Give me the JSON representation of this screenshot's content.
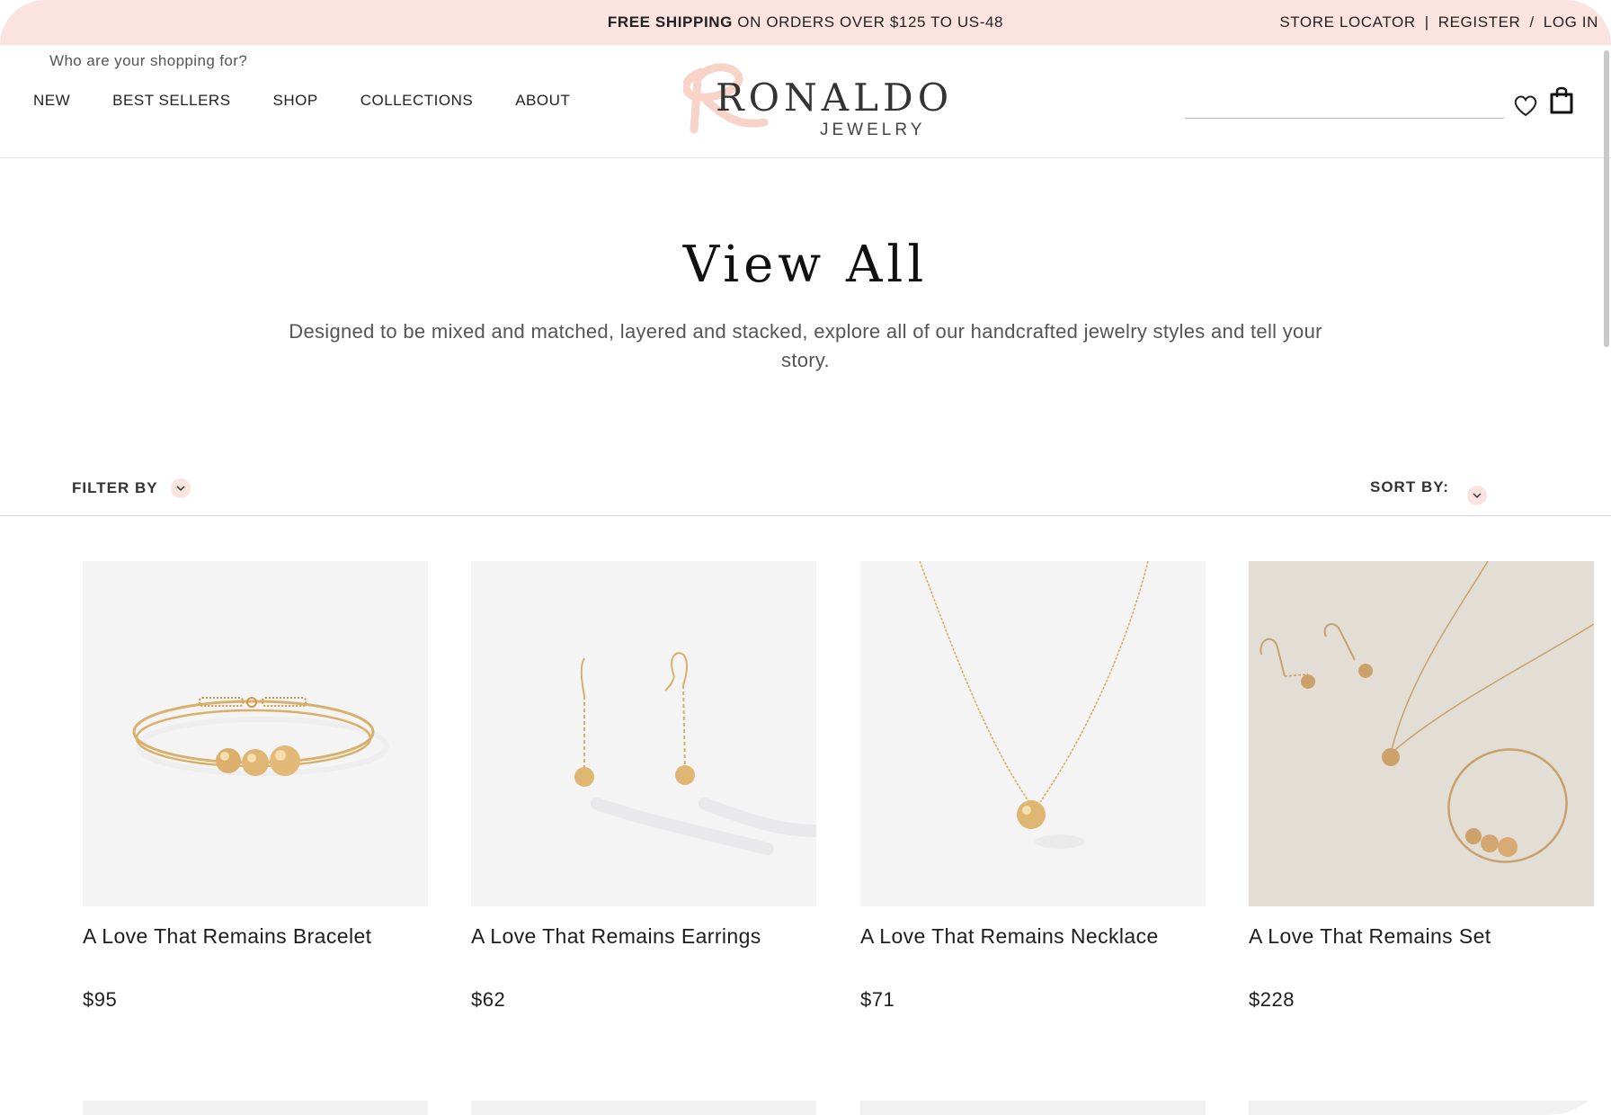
{
  "announcement": {
    "bold": "FREE SHIPPING",
    "rest": " ON ORDERS OVER $125 TO US-48",
    "store_locator": "STORE LOCATOR",
    "sep1": "|",
    "register": "REGISTER",
    "sep2": "/",
    "login": "LOG IN"
  },
  "header": {
    "shop_for": "Who are your shopping for?",
    "nav": [
      "NEW",
      "BEST SELLERS",
      "SHOP",
      "COLLECTIONS",
      "ABOUT"
    ],
    "logo_word": "RONALDO",
    "logo_sub": "JEWELRY",
    "icons": [
      "heart-icon",
      "shopping-bag-icon"
    ]
  },
  "hero": {
    "title": "View All",
    "description": "Designed to be mixed and matched, layered and stacked, explore all of our handcrafted jewelry styles and tell your story."
  },
  "filters": {
    "filter_label": "FILTER BY",
    "sort_label": "SORT BY:"
  },
  "products": [
    {
      "name": "A Love That Remains Bracelet",
      "price": "$95"
    },
    {
      "name": "A Love That Remains Earrings",
      "price": "$62"
    },
    {
      "name": "A Love That Remains Necklace",
      "price": "$71"
    },
    {
      "name": "A Love That Remains Set",
      "price": "$228"
    }
  ],
  "colors": {
    "accent": "#fbe4df",
    "gold": "#d9b06a",
    "text": "#1d1d1d"
  }
}
